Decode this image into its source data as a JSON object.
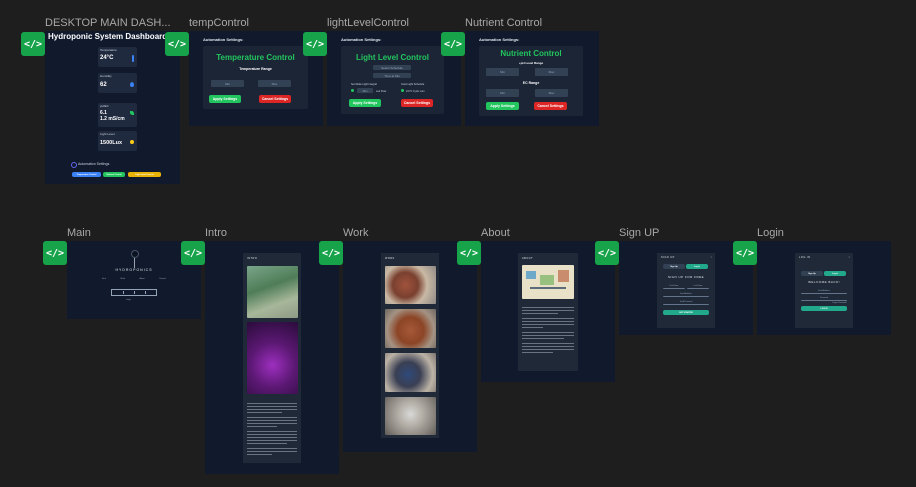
{
  "frames": {
    "desktop": {
      "label": "DESKTOP MAIN DASH...",
      "title": "Hydroponic System Dashboard",
      "cards": [
        {
          "label": "Temperature",
          "value": "24°C",
          "icon": "thermometer-icon"
        },
        {
          "label": "Humidity",
          "value": "62",
          "icon": "drop-icon"
        },
        {
          "label": "pH/EC",
          "value": "6.1",
          "value2": "1.2 mS/cm",
          "icon": "leaf-icon"
        },
        {
          "label": "Light Level",
          "value": "1500Lux",
          "icon": "sun-icon"
        }
      ],
      "automation_label": "Automation Settings",
      "buttons": [
        "Temperature Control",
        "Nutrient Control",
        "Light Level Control"
      ]
    },
    "temp": {
      "label": "tempControl",
      "settings": "Automation Settings:",
      "title": "Temperature Control",
      "subtitle": "Temperature Range",
      "min": "Min",
      "max": "Max",
      "apply": "Apply Settings",
      "cancel": "Cancel Settings"
    },
    "light": {
      "label": "lightLevelControl",
      "settings": "Automation Settings:",
      "title": "Light Level Control",
      "select_schedule": "Select Schedule",
      "time": "Time at Min",
      "left_label": "Set Mode Light Integral",
      "right_label": "Grow Light Schedule",
      "field": "Min",
      "left_radio": "Led Flow",
      "right_radio": "24 Hr Cycle Lum",
      "apply": "Apply Settings",
      "cancel": "Cancel Settings"
    },
    "nutrient": {
      "label": "Nutrient Control",
      "settings": "Automation Settings:",
      "title": "Nutrient Control",
      "ph_range": "+pH Level Range",
      "ec_range": "EC Range",
      "min": "Min",
      "max": "Max",
      "apply": "Apply Settings",
      "cancel": "Cancel Settings"
    },
    "main": {
      "label": "Main",
      "brand": "HYDROPONICS",
      "nav": [
        "Intro",
        "Work",
        "About",
        "Contact"
      ],
      "buttons": [
        "Sign Up",
        "Login"
      ]
    },
    "intro": {
      "label": "Intro",
      "heading": "INTRO"
    },
    "work": {
      "label": "Work",
      "heading": "WORK"
    },
    "about": {
      "label": "About",
      "heading": "ABOUT"
    },
    "signup": {
      "label": "Sign UP",
      "heading": "SIGN UP",
      "tabs": [
        "Sign Up",
        "Log In"
      ],
      "title": "SIGN UP FOR FREE",
      "fields": [
        "First Name",
        "Last Name",
        "Email Address",
        "Set A Password"
      ],
      "button": "GET STARTED"
    },
    "login": {
      "label": "Login",
      "heading": "LOG IN",
      "tabs": [
        "Sign Up",
        "Log In"
      ],
      "title": "WELCOME BACK!",
      "fields": [
        "Email Address",
        "Password"
      ],
      "forgot": "Forgot Password?",
      "button": "LOG IN"
    }
  }
}
